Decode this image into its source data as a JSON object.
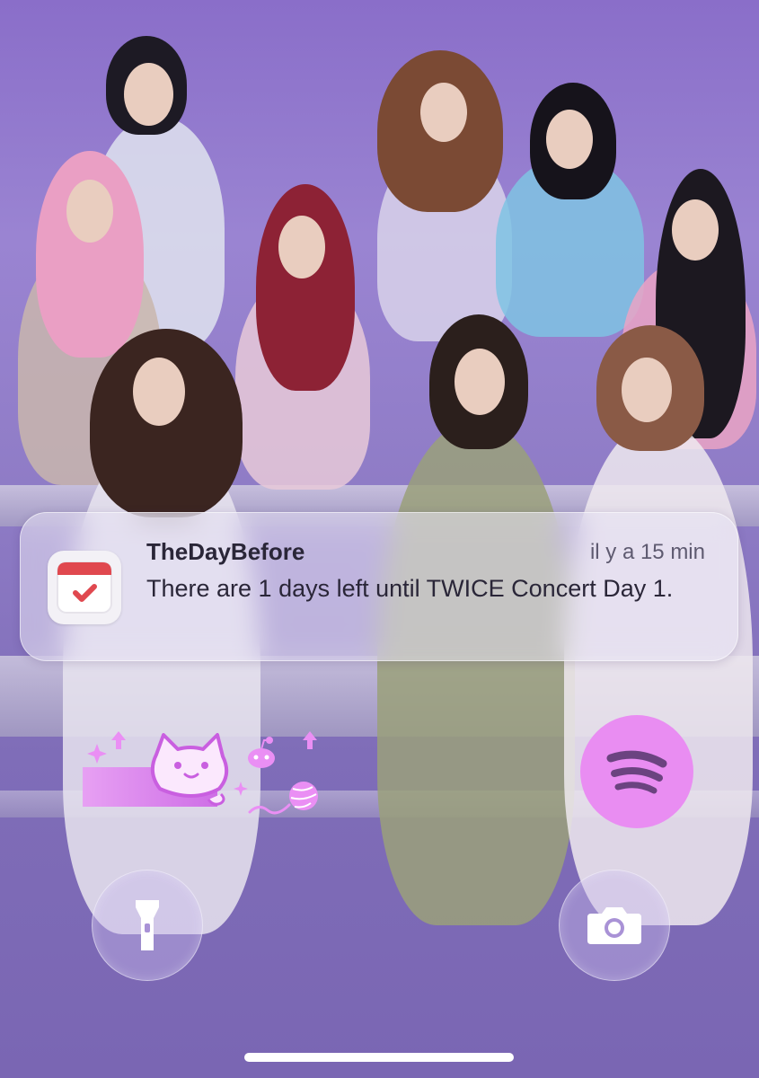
{
  "notification": {
    "app_name": "TheDayBefore",
    "time": "il y a 15 min",
    "message": "There are 1 days left until TWICE Concert Day 1.",
    "icon": "calendar-check-icon"
  },
  "widgets": {
    "sticker": "cat-reddit-sticker",
    "spotify_icon": "spotify-icon"
  },
  "quick_actions": {
    "flashlight_icon": "flashlight-icon",
    "camera_icon": "camera-icon"
  },
  "colors": {
    "accent_pink": "#e98df2",
    "wallpaper_purple": "#8a6ec9",
    "calendar_red": "#e0484f"
  }
}
